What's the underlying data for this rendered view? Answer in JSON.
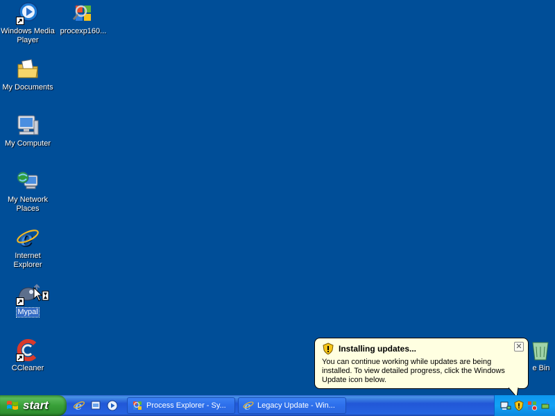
{
  "desktop": {
    "icons": [
      {
        "label": "Windows Media Player",
        "icon": "windows-media-player-icon"
      },
      {
        "label": "procexp160...",
        "icon": "process-explorer-icon"
      },
      {
        "label": "My Documents",
        "icon": "my-documents-icon"
      },
      {
        "label": "My Computer",
        "icon": "my-computer-icon"
      },
      {
        "label": "My Network Places",
        "icon": "my-network-places-icon"
      },
      {
        "label": "Internet Explorer",
        "icon": "internet-explorer-icon"
      },
      {
        "label": "Mypal",
        "icon": "mypal-icon"
      },
      {
        "label": "CCleaner",
        "icon": "ccleaner-icon"
      },
      {
        "label": "e Bin",
        "icon": "recycle-bin-icon"
      }
    ]
  },
  "taskbar": {
    "start_label": "start",
    "tasks": [
      {
        "label": "Process Explorer - Sy..."
      },
      {
        "label": "Legacy Update - Win..."
      }
    ]
  },
  "balloon": {
    "title": "Installing updates...",
    "body": "You can continue working while updates are being installed. To view detailed progress, click the Windows Update icon below.",
    "close_glyph": "✕"
  },
  "colors": {
    "desktop": "#004E98",
    "taskbar": "#2157D7",
    "start_button": "#38A038",
    "balloon": "#FFFFE1"
  }
}
